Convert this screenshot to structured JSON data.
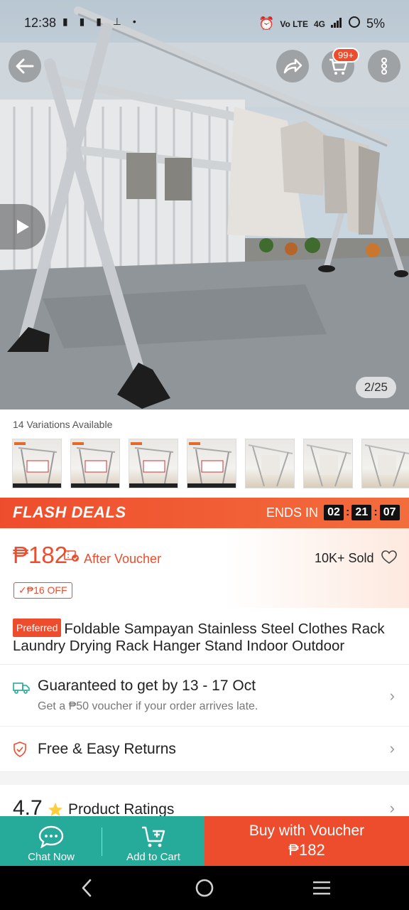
{
  "status_bar": {
    "time": "12:38",
    "battery": "5%",
    "network": "4G",
    "left_icons": "▮ ▮ ▮ ⊥ •",
    "lte_label": "Vo LTE"
  },
  "hero": {
    "image_counter": "2/25",
    "cart_badge": "99+"
  },
  "variations": {
    "label": "14 Variations Available",
    "thumbs": [
      "v1",
      "v2",
      "v3",
      "v4",
      "v5",
      "v6",
      "v7"
    ]
  },
  "flash_deals": {
    "title": "FLASH DEALS",
    "ends_label": "ENDS IN",
    "hours": "02",
    "minutes": "21",
    "seconds": "07"
  },
  "price": {
    "amount": "₱182",
    "after_voucher": "After Voucher",
    "sold": "10K+ Sold",
    "off_tag": "✓₱16 OFF"
  },
  "product": {
    "preferred_badge": "Preferred",
    "title": "Foldable Sampayan Stainless Steel Clothes Rack Laundry Drying Rack Hanger Stand Indoor Outdoor"
  },
  "shipping": {
    "main": "Guaranteed to get by 13 - 17 Oct",
    "sub": "Get a ₱50 voucher if your order arrives late."
  },
  "returns": {
    "main": "Free & Easy Returns"
  },
  "ratings": {
    "score": "4.7",
    "label": "Product Ratings"
  },
  "action_bar": {
    "chat_label": "Chat Now",
    "cart_label": "Add to Cart",
    "buy_label": "Buy with Voucher",
    "buy_price": "₱182"
  },
  "colors": {
    "brand": "#ee4d2d",
    "teal": "#26aa99"
  }
}
